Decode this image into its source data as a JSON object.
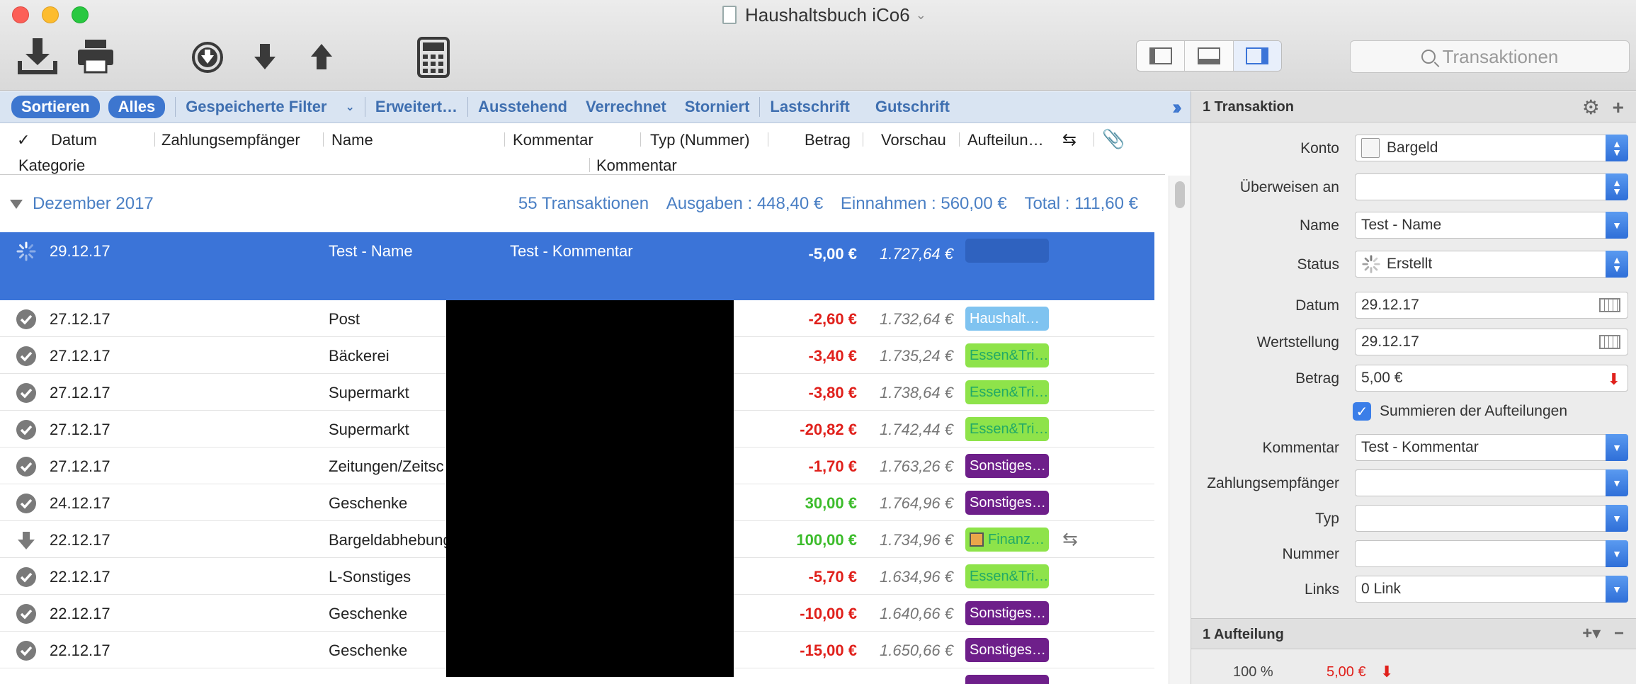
{
  "window": {
    "title": "Haushaltsbuch iCo6"
  },
  "toolbar": {
    "search_placeholder": "Transaktionen"
  },
  "filters": {
    "sort_label": "Sortieren",
    "all_label": "Alles",
    "saved_filters_label": "Gespeicherte Filter",
    "items": [
      "Erweitert…",
      "Ausstehend",
      "Verrechnet",
      "Storniert",
      "Lastschrift",
      "Gutschrift"
    ]
  },
  "columns": {
    "check": "✓",
    "date": "Datum",
    "payee": "Zahlungsempfänger",
    "name": "Name",
    "comment": "Kommentar",
    "type": "Typ (Nummer)",
    "amount": "Betrag",
    "preview": "Vorschau",
    "split": "Aufteilun…",
    "category": "Kategorie",
    "comment2": "Kommentar"
  },
  "group": {
    "title": "Dezember 2017",
    "count": "55 Transaktionen",
    "expenses": "Ausgaben : 448,40 €",
    "income": "Einnahmen : 560,00 €",
    "total": "Total : 111,60 €"
  },
  "transactions": [
    {
      "date": "29.12.17",
      "name": "Test - Name",
      "comment": "Test - Kommentar",
      "amount": "-5,00 €",
      "balance": "1.727,64 €",
      "category": "",
      "status": "pending"
    },
    {
      "date": "27.12.17",
      "name": "Post",
      "comment": "",
      "amount": "-2,60 €",
      "balance": "1.732,64 €",
      "category": "Haushalt…",
      "status": "cleared"
    },
    {
      "date": "27.12.17",
      "name": "Bäckerei",
      "comment": "",
      "amount": "-3,40 €",
      "balance": "1.735,24 €",
      "category": "Essen&Tri…",
      "status": "cleared"
    },
    {
      "date": "27.12.17",
      "name": "Supermarkt",
      "comment": "",
      "amount": "-3,80 €",
      "balance": "1.738,64 €",
      "category": "Essen&Tri…",
      "status": "cleared"
    },
    {
      "date": "27.12.17",
      "name": "Supermarkt",
      "comment": "",
      "amount": "-20,82 €",
      "balance": "1.742,44 €",
      "category": "Essen&Tri…",
      "status": "cleared"
    },
    {
      "date": "27.12.17",
      "name": "Zeitungen/Zeitsc",
      "comment": "",
      "amount": "-1,70 €",
      "balance": "1.763,26 €",
      "category": "Sonstiges…",
      "status": "cleared"
    },
    {
      "date": "24.12.17",
      "name": "Geschenke",
      "comment": "",
      "amount": "30,00 €",
      "balance": "1.764,96 €",
      "category": "Sonstiges…",
      "status": "cleared"
    },
    {
      "date": "22.12.17",
      "name": "Bargeldabhebung",
      "comment": "",
      "amount": "100,00 €",
      "balance": "1.734,96 €",
      "category": "Finanz…",
      "status": "download"
    },
    {
      "date": "22.12.17",
      "name": "L-Sonstiges",
      "comment": "",
      "amount": "-5,70 €",
      "balance": "1.634,96 €",
      "category": "Essen&Tri…",
      "status": "cleared"
    },
    {
      "date": "22.12.17",
      "name": "Geschenke",
      "comment": "",
      "amount": "-10,00 €",
      "balance": "1.640,66 €",
      "category": "Sonstiges…",
      "status": "cleared"
    },
    {
      "date": "22.12.17",
      "name": "Geschenke",
      "comment": "",
      "amount": "-15,00 €",
      "balance": "1.650,66 €",
      "category": "Sonstiges…",
      "status": "cleared"
    }
  ],
  "inspector": {
    "header": "1 Transaktion",
    "fields": {
      "account_label": "Konto",
      "account_value": "Bargeld",
      "transfer_label": "Überweisen an",
      "transfer_value": "",
      "name_label": "Name",
      "name_value": "Test - Name",
      "status_label": "Status",
      "status_value": "Erstellt",
      "date_label": "Datum",
      "date_value": "29.12.17",
      "valuedate_label": "Wertstellung",
      "valuedate_value": "29.12.17",
      "amount_label": "Betrag",
      "amount_value": "5,00 €",
      "sum_splits_label": "Summieren der Aufteilungen",
      "comment_label": "Kommentar",
      "comment_value": "Test - Kommentar",
      "payee_label": "Zahlungsempfänger",
      "payee_value": "",
      "type_label": "Typ",
      "type_value": "",
      "number_label": "Nummer",
      "number_value": "",
      "links_label": "Links",
      "links_value": "0 Link"
    },
    "split_header": "1 Aufteilung",
    "split_percent": "100 %",
    "split_amount": "5,00 €"
  },
  "colors": {
    "accent": "#3b74d8",
    "negative": "#e0201b",
    "positive": "#3cbc2b"
  }
}
